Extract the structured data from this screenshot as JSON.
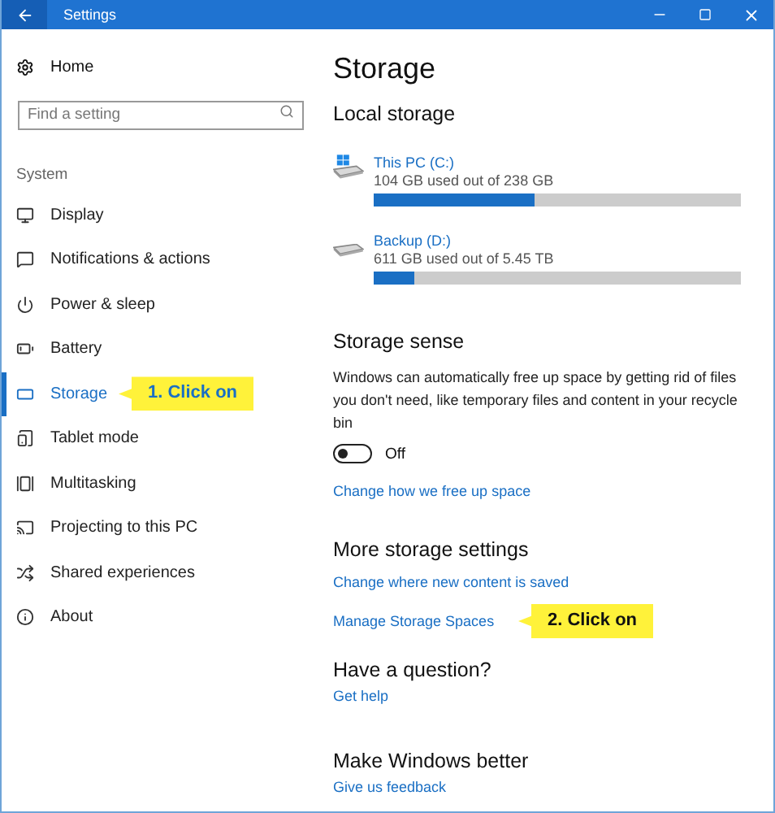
{
  "window": {
    "title": "Settings"
  },
  "sidebar": {
    "home": "Home",
    "search": {
      "placeholder": "Find a setting"
    },
    "section": "System",
    "items": [
      {
        "label": "Display",
        "selected": false
      },
      {
        "label": "Notifications & actions",
        "selected": false
      },
      {
        "label": "Power & sleep",
        "selected": false
      },
      {
        "label": "Battery",
        "selected": false
      },
      {
        "label": "Storage",
        "selected": true,
        "callout": "1. Click on"
      },
      {
        "label": "Tablet mode",
        "selected": false
      },
      {
        "label": "Multitasking",
        "selected": false
      },
      {
        "label": "Projecting to this PC",
        "selected": false
      },
      {
        "label": "Shared experiences",
        "selected": false
      },
      {
        "label": "About",
        "selected": false
      }
    ]
  },
  "page": {
    "title": "Storage",
    "local_storage": {
      "heading": "Local storage",
      "drives": [
        {
          "kind": "system",
          "name": "This PC (C:)",
          "usage": "104 GB used out of 238 GB",
          "level": 0.44
        },
        {
          "kind": "plain",
          "name": "Backup (D:)",
          "usage": "611 GB used out of 5.45 TB",
          "level": 0.11
        }
      ]
    },
    "storage_sense": {
      "heading": "Storage sense",
      "description": "Windows can automatically free up space by getting rid of files you don't need, like temporary files and content in your recycle bin",
      "toggle": {
        "on": false,
        "label": "Off"
      },
      "link": "Change how we free up space"
    },
    "more_settings": {
      "heading": "More storage settings",
      "links": [
        {
          "label": "Change where new content is saved"
        },
        {
          "label": "Manage Storage Spaces",
          "callout": "2. Click on"
        }
      ]
    },
    "question": {
      "heading": "Have a question?",
      "link": "Get help"
    },
    "feedback": {
      "heading": "Make Windows better",
      "link": "Give us feedback"
    }
  }
}
